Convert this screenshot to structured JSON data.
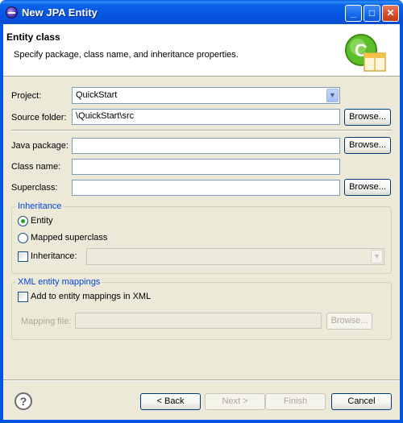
{
  "window": {
    "title": "New JPA Entity"
  },
  "titlebar_buttons": {
    "minimize": "_",
    "maximize": "□",
    "close": "✕"
  },
  "banner": {
    "title": "Entity class",
    "description": "Specify package, class name, and inheritance properties."
  },
  "form": {
    "project_label": "Project:",
    "project_value": "QuickStart",
    "source_folder_label": "Source folder:",
    "source_folder_value": "\\QuickStart\\src",
    "java_package_label": "Java package:",
    "java_package_value": "",
    "class_name_label": "Class name:",
    "class_name_value": "",
    "superclass_label": "Superclass:",
    "superclass_value": "",
    "browse_label": "Browse..."
  },
  "inheritance": {
    "group_title": "Inheritance",
    "entity_label": "Entity",
    "entity_selected": true,
    "mapped_superclass_label": "Mapped superclass",
    "inheritance_label": "Inheritance:",
    "inheritance_checked": false
  },
  "xml_mappings": {
    "group_title": "XML entity mappings",
    "add_label": "Add to entity mappings in XML",
    "add_checked": false,
    "mapping_file_label": "Mapping file:",
    "mapping_file_value": "",
    "browse_label": "Browse..."
  },
  "footer": {
    "help_icon": "?",
    "back_label": "< Back",
    "next_label": "Next >",
    "finish_label": "Finish",
    "cancel_label": "Cancel"
  }
}
